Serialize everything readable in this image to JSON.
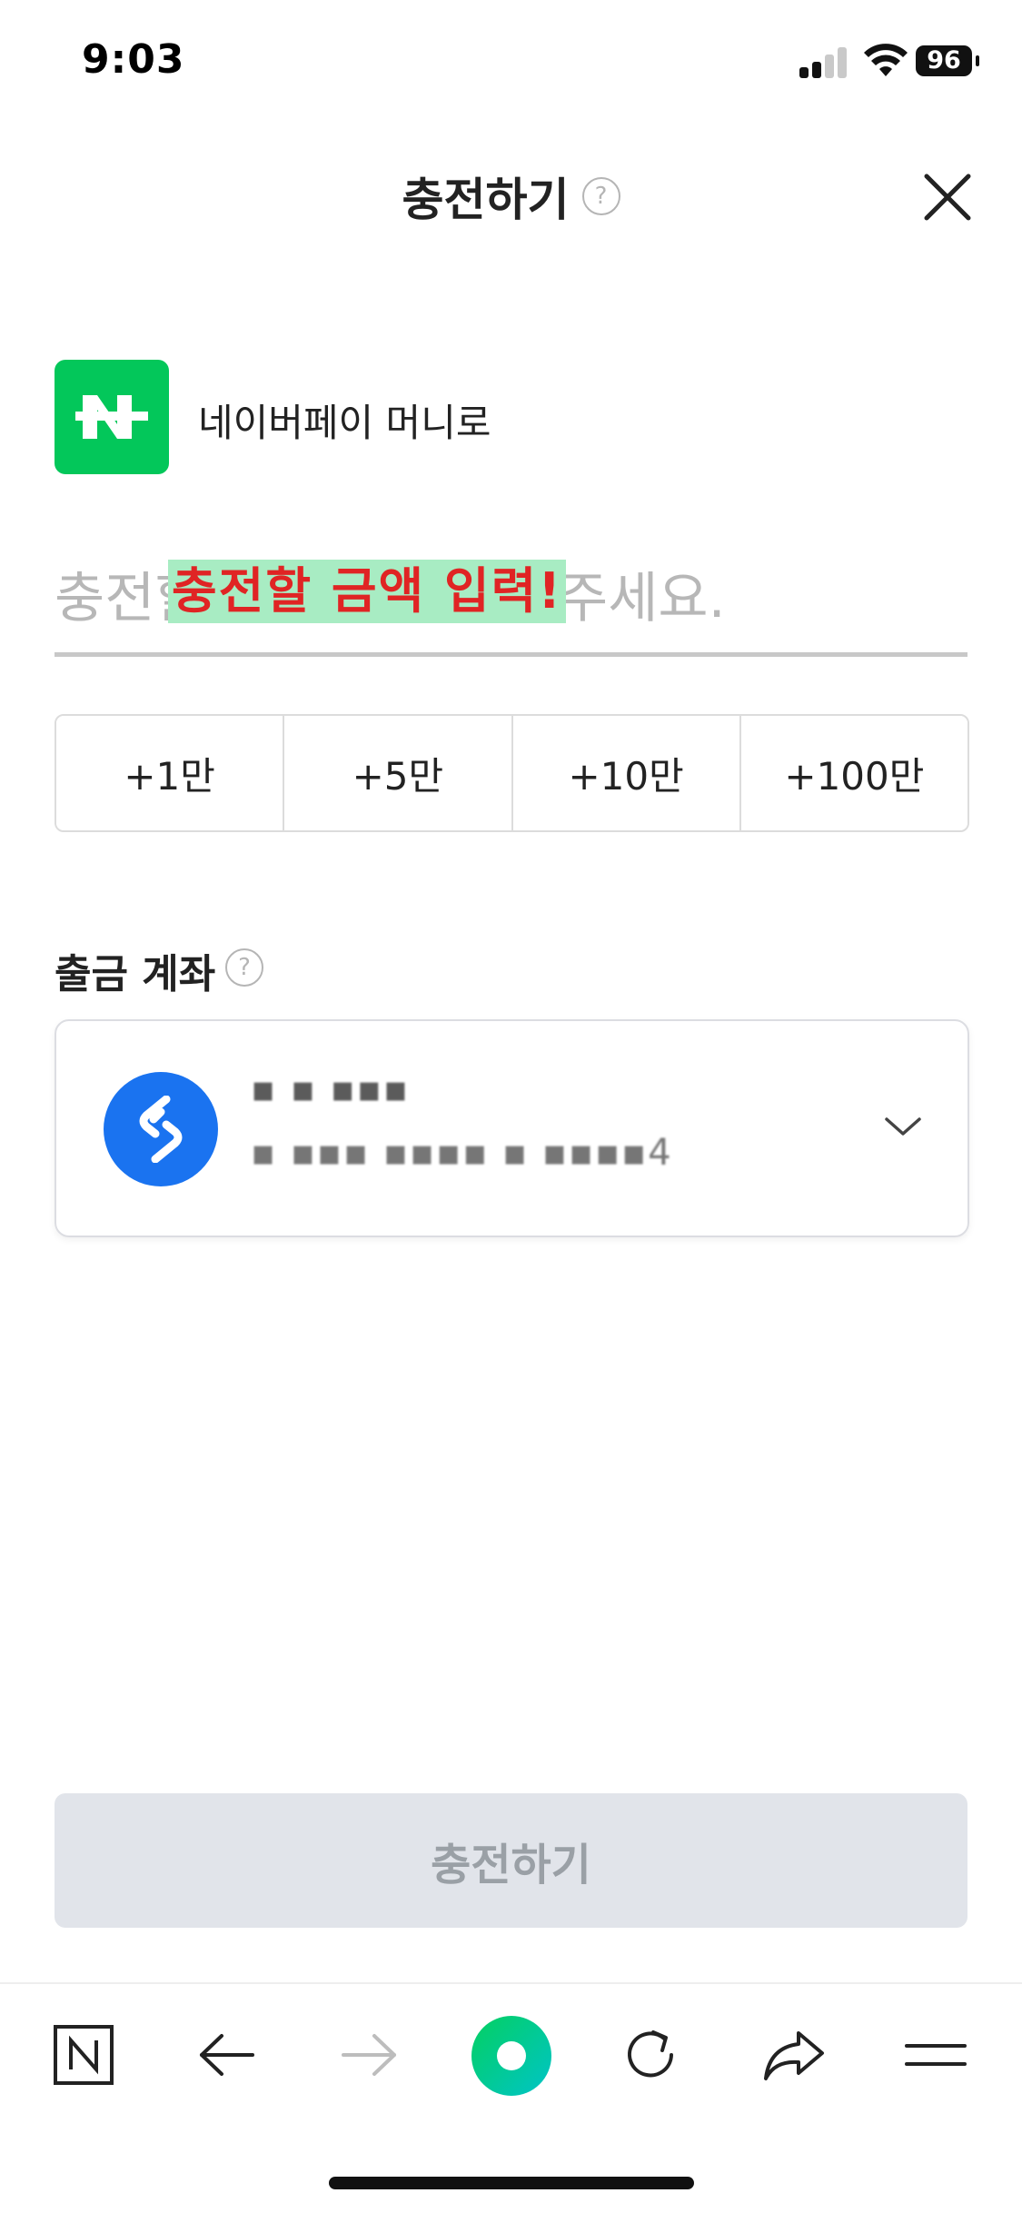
{
  "status_bar": {
    "time": "9:03",
    "battery": "96"
  },
  "header": {
    "title": "충전하기",
    "help_icon": "?"
  },
  "payment_method": {
    "label": "네이버페이 머니로"
  },
  "amount": {
    "placeholder": "충전할 금액을 입력해 주세요.",
    "overlay_text": "충전할 금액 입력!"
  },
  "quick_amounts": [
    "+1만",
    "+5만",
    "+10만",
    "+100만"
  ],
  "account_section": {
    "label": "출금 계좌",
    "help_icon": "?",
    "account_name": "▪ ▪ ▪▪▪",
    "account_number": "▪ ▪▪▪ ▪▪▪▪ ▪ ▪▪▪▪4"
  },
  "submit": {
    "label": "충전하기",
    "enabled": false
  },
  "colors": {
    "naver_green": "#03c75a",
    "bank_blue": "#1a73f0",
    "highlight_bg": "#a8ecc3",
    "highlight_text": "#e02424",
    "disabled_button": "#e1e4ea"
  },
  "toolbar_icons": [
    "naver-n-icon",
    "back-arrow-icon",
    "forward-arrow-icon",
    "green-dot-icon",
    "refresh-icon",
    "share-icon",
    "menu-icon"
  ]
}
